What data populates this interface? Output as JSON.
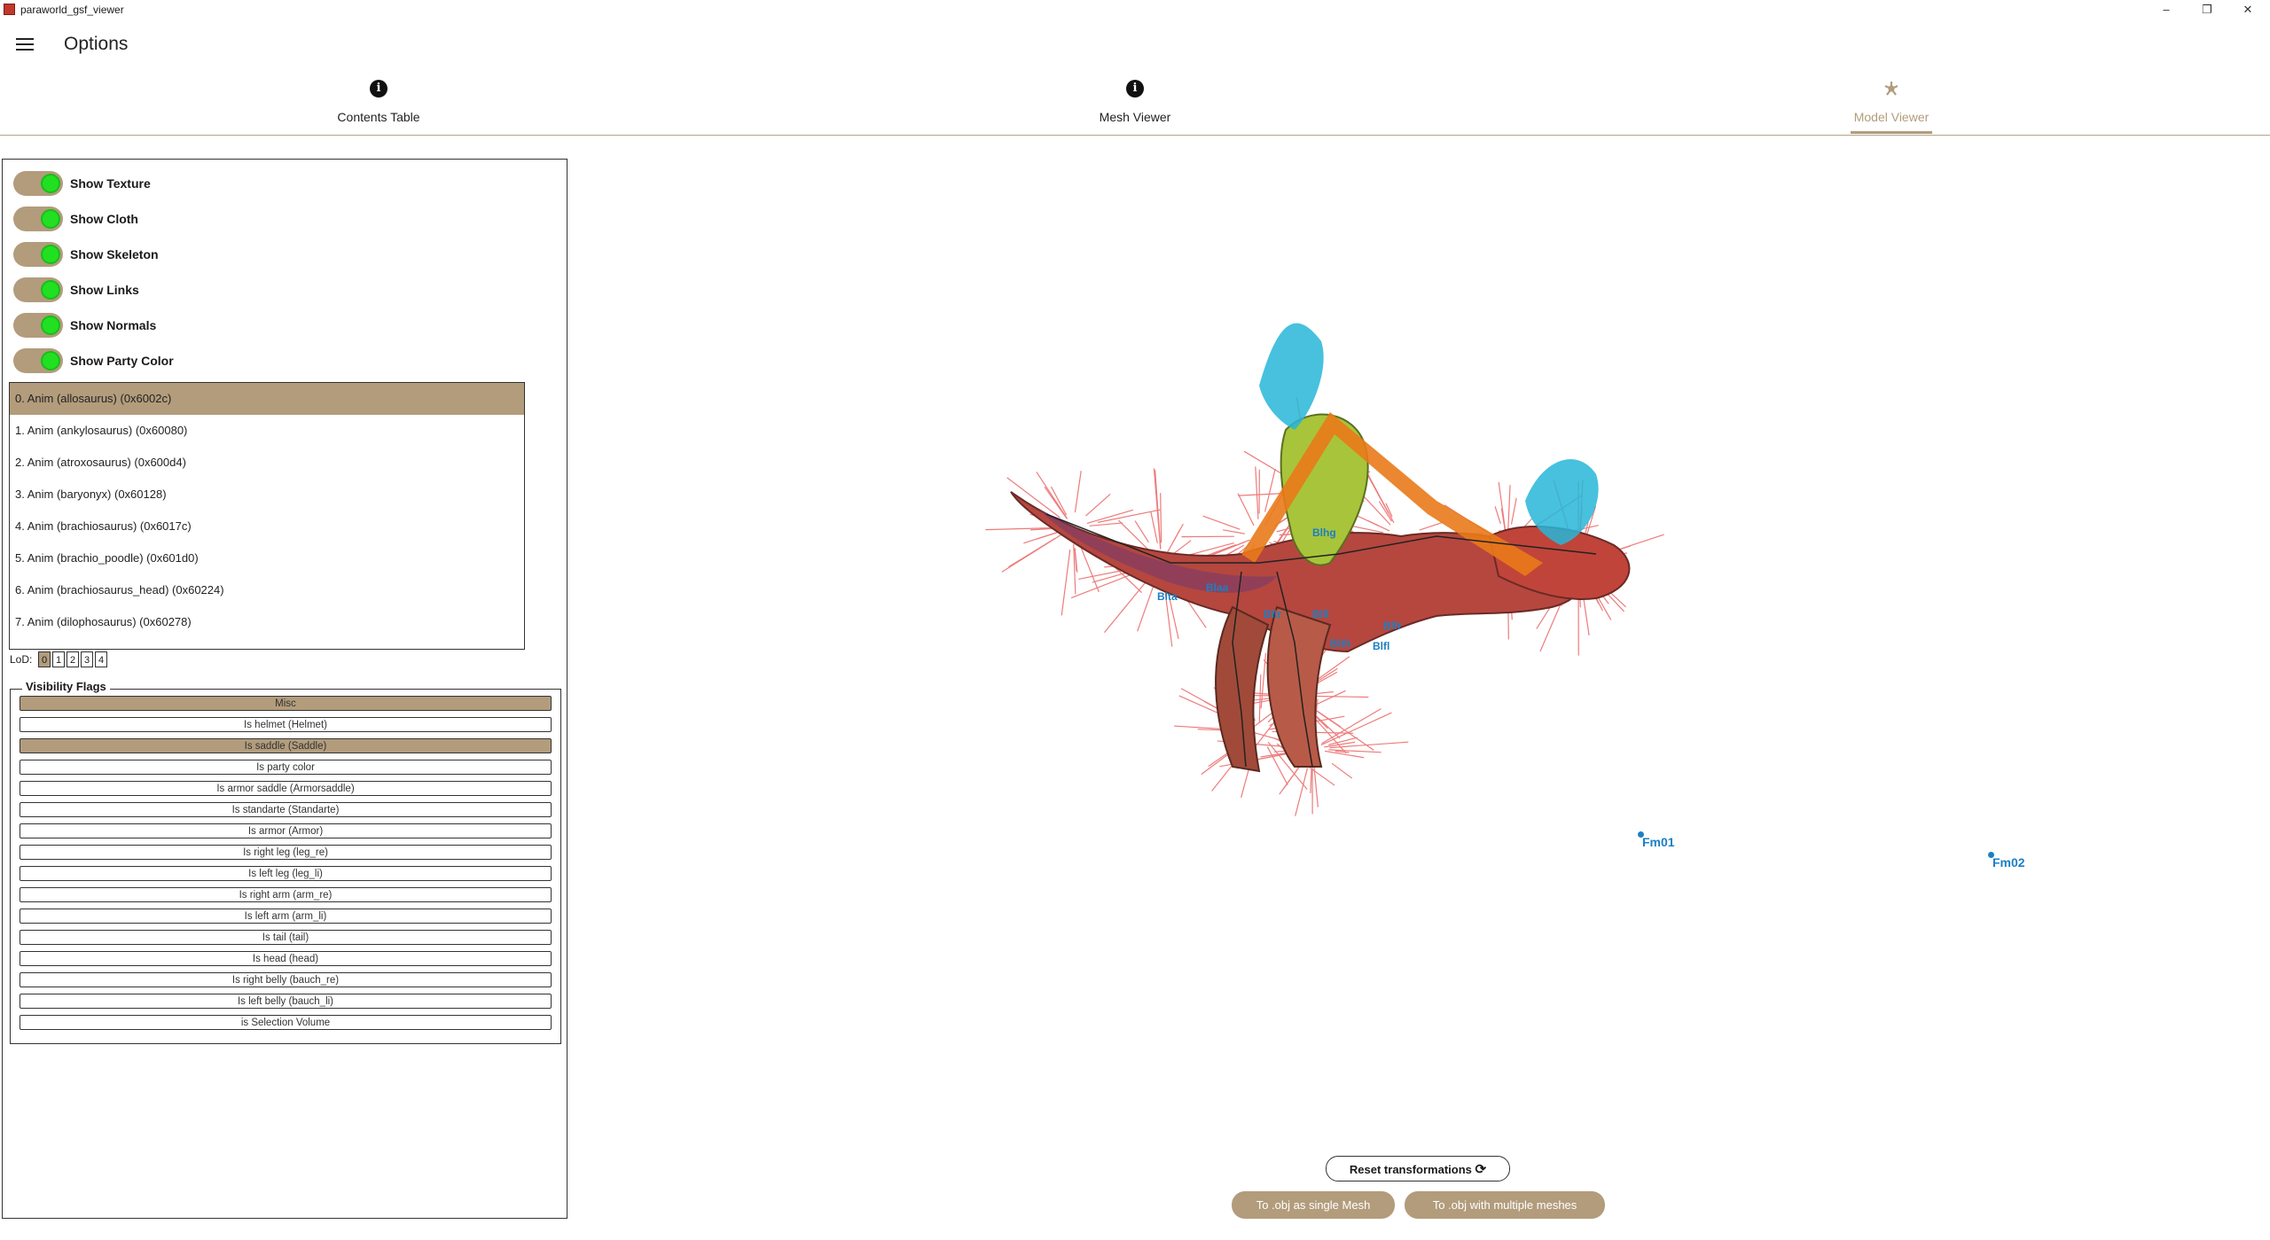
{
  "window": {
    "title": "paraworld_gsf_viewer",
    "minimize": "–",
    "restore": "❐",
    "close": "✕"
  },
  "appbar": {
    "title": "Options"
  },
  "tabs": [
    {
      "label": "Contents Table",
      "icon": "info-icon"
    },
    {
      "label": "Mesh Viewer",
      "icon": "info-icon"
    },
    {
      "label": "Model Viewer",
      "icon": "model-icon",
      "active": true
    }
  ],
  "toggles": [
    {
      "label": "Show Texture",
      "on": true
    },
    {
      "label": "Show Cloth",
      "on": true
    },
    {
      "label": "Show Skeleton",
      "on": true
    },
    {
      "label": "Show Links",
      "on": true
    },
    {
      "label": "Show Normals",
      "on": true
    },
    {
      "label": "Show Party Color",
      "on": true
    }
  ],
  "animations": [
    "0. Anim (allosaurus) (0x6002c)",
    "1. Anim (ankylosaurus) (0x60080)",
    "2. Anim (atroxosaurus) (0x600d4)",
    "3. Anim (baryonyx) (0x60128)",
    "4. Anim (brachiosaurus) (0x6017c)",
    "5. Anim (brachio_poodle) (0x601d0)",
    "6. Anim (brachiosaurus_head) (0x60224)",
    "7. Anim (dilophosaurus) (0x60278)"
  ],
  "selected_animation": 0,
  "lod": {
    "label": "LoD:",
    "levels": [
      "0",
      "1",
      "2",
      "3",
      "4"
    ],
    "selected": 0
  },
  "visibility": {
    "legend": "Visibility Flags",
    "flags": [
      "Misc",
      "Is helmet (Helmet)",
      "Is saddle (Saddle)",
      "Is party color",
      "Is armor saddle (Armorsaddle)",
      "Is standarte (Standarte)",
      "Is armor (Armor)",
      "Is right leg (leg_re)",
      "Is left leg (leg_li)",
      "Is right arm (arm_re)",
      "Is left arm (arm_li)",
      "Is tail (tail)",
      "Is head (head)",
      "Is right belly (bauch_re)",
      "Is left belly (bauch_li)",
      "is Selection Volume"
    ],
    "selected": [
      0,
      2
    ]
  },
  "viewer": {
    "markers": [
      "Fm01",
      "Fm02"
    ],
    "bone_labels": [
      "Blta",
      "Blaa",
      "Bllr",
      "Blll",
      "Bith",
      "Blfr",
      "Blfl",
      "Blhg"
    ]
  },
  "buttons": {
    "reset": "Reset transformations",
    "export_single": "To .obj as single Mesh",
    "export_multi": "To .obj with multiple meshes"
  },
  "colors": {
    "accent": "#b29c7c",
    "toggle_on": "#21e021",
    "marker": "#1b7fc4",
    "normals": "#e85050"
  }
}
